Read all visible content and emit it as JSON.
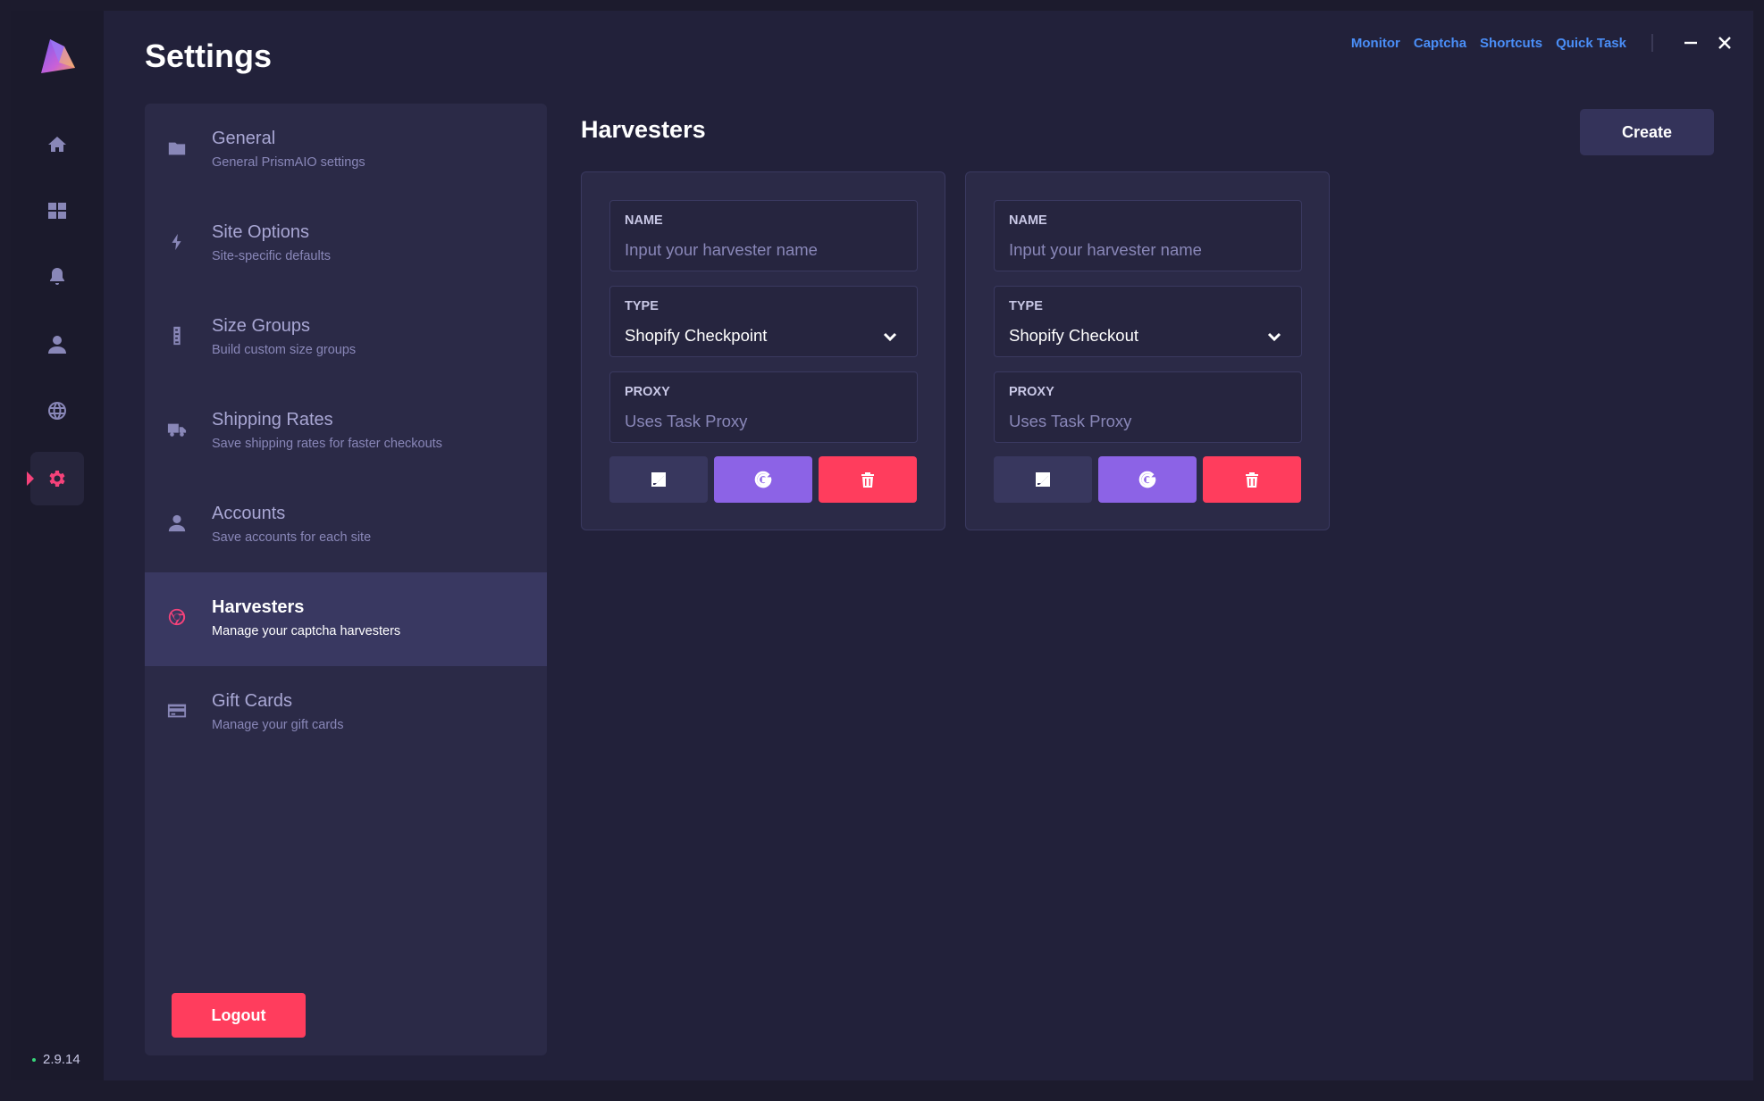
{
  "app": {
    "title": "Settings",
    "version": "2.9.14",
    "accent": "#f5427a",
    "link_color": "#4a8ef7"
  },
  "header_links": [
    "Monitor",
    "Captcha",
    "Shortcuts",
    "Quick Task"
  ],
  "rail": {
    "items": [
      {
        "icon": "home-icon"
      },
      {
        "icon": "dashboard-icon"
      },
      {
        "icon": "bell-icon"
      },
      {
        "icon": "user-icon"
      },
      {
        "icon": "globe-icon"
      },
      {
        "icon": "gear-icon",
        "active": true
      }
    ]
  },
  "settings_nav": {
    "items": [
      {
        "title": "General",
        "subtitle": "General PrismAIO settings",
        "icon": "folder-icon"
      },
      {
        "title": "Site Options",
        "subtitle": "Site-specific defaults",
        "icon": "bolt-icon"
      },
      {
        "title": "Size Groups",
        "subtitle": "Build custom size groups",
        "icon": "ruler-icon"
      },
      {
        "title": "Shipping Rates",
        "subtitle": "Save shipping rates for faster checkouts",
        "icon": "truck-icon"
      },
      {
        "title": "Accounts",
        "subtitle": "Save accounts for each site",
        "icon": "user-icon"
      },
      {
        "title": "Harvesters",
        "subtitle": "Manage your captcha harvesters",
        "icon": "chrome-icon",
        "active": true
      },
      {
        "title": "Gift Cards",
        "subtitle": "Manage your gift cards",
        "icon": "credit-card-icon"
      }
    ],
    "logout_label": "Logout"
  },
  "harvesters": {
    "title": "Harvesters",
    "create_label": "Create",
    "cards": [
      {
        "name_label": "NAME",
        "name_value": "",
        "name_placeholder": "Input your harvester name",
        "type_label": "TYPE",
        "type_value": "Shopify Checkpoint",
        "proxy_label": "PROXY",
        "proxy_value": "",
        "proxy_placeholder": "Uses Task Proxy"
      },
      {
        "name_label": "NAME",
        "name_value": "",
        "name_placeholder": "Input your harvester name",
        "type_label": "TYPE",
        "type_value": "Shopify Checkout",
        "proxy_label": "PROXY",
        "proxy_value": "",
        "proxy_placeholder": "Uses Task Proxy"
      }
    ]
  }
}
